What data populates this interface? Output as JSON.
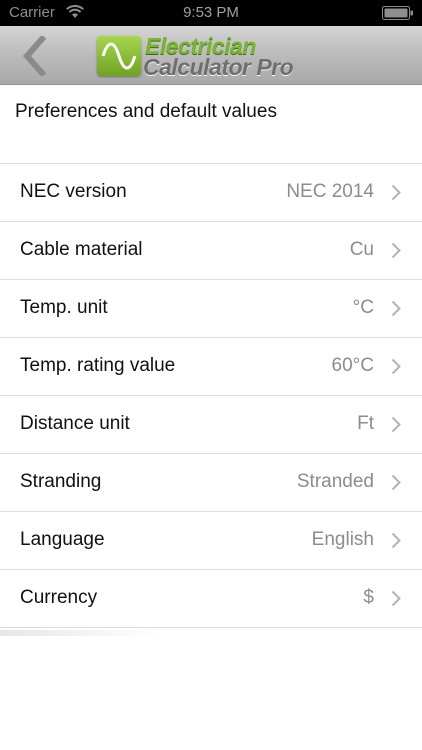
{
  "status_bar": {
    "carrier": "Carrier",
    "time": "9:53 PM"
  },
  "nav_bar": {
    "back_icon": "chevron-left-icon",
    "logo_line_1": "Electrician",
    "logo_line_2": "Calculator Pro",
    "logo_icon": "sine-wave-icon"
  },
  "section": {
    "title": "Preferences and default values"
  },
  "settings": [
    {
      "label": "NEC version",
      "value": "NEC 2014"
    },
    {
      "label": "Cable material",
      "value": "Cu"
    },
    {
      "label": "Temp. unit",
      "value": "°C"
    },
    {
      "label": "Temp. rating value",
      "value": "60°C"
    },
    {
      "label": "Distance unit",
      "value": "Ft"
    },
    {
      "label": "Stranding",
      "value": "Stranded"
    },
    {
      "label": "Language",
      "value": "English"
    },
    {
      "label": "Currency",
      "value": "$"
    }
  ],
  "colors": {
    "logo_green": "#7ab532",
    "logo_gray": "#6e6e6e",
    "value_gray": "#8c8c8c",
    "divider": "#dcdcdc"
  }
}
